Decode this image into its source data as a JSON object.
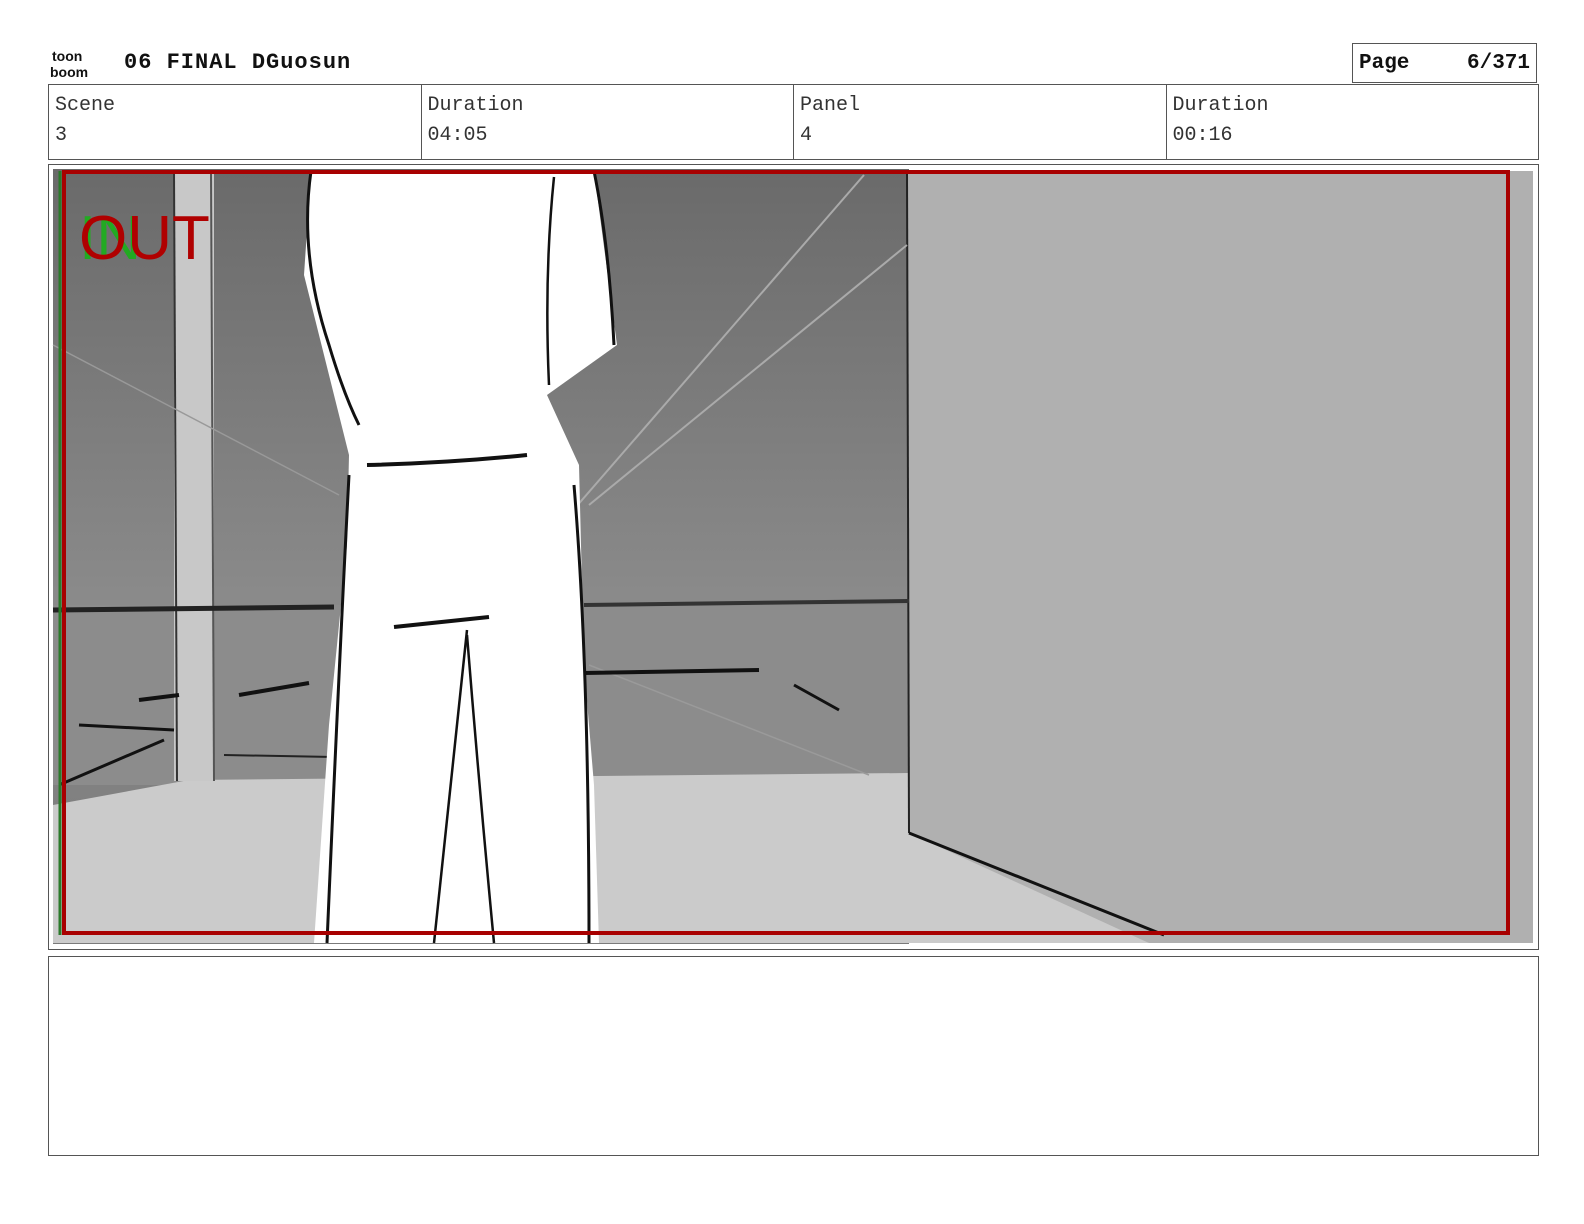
{
  "header": {
    "logo_text_top": "toon",
    "logo_text_bottom": "boom",
    "doc_title": "06 FINAL DGuosun",
    "page_label": "Page",
    "page_value": "6/371"
  },
  "info": {
    "scene_label": "Scene",
    "scene_value": "3",
    "scene_duration_label": "Duration",
    "scene_duration_value": "04:05",
    "panel_label": "Panel",
    "panel_value": "4",
    "panel_duration_label": "Duration",
    "panel_duration_value": "00:16"
  },
  "panel": {
    "in_marker": "IN",
    "out_marker": "OUT",
    "colors": {
      "safe_frame": "#a80000",
      "in_marker": "#22aa22",
      "out_marker": "#b00000",
      "wall": "#b0b0b0",
      "sky": "#6e6e6e",
      "floor": "#cbcbcb"
    }
  },
  "notes": {
    "text": ""
  }
}
